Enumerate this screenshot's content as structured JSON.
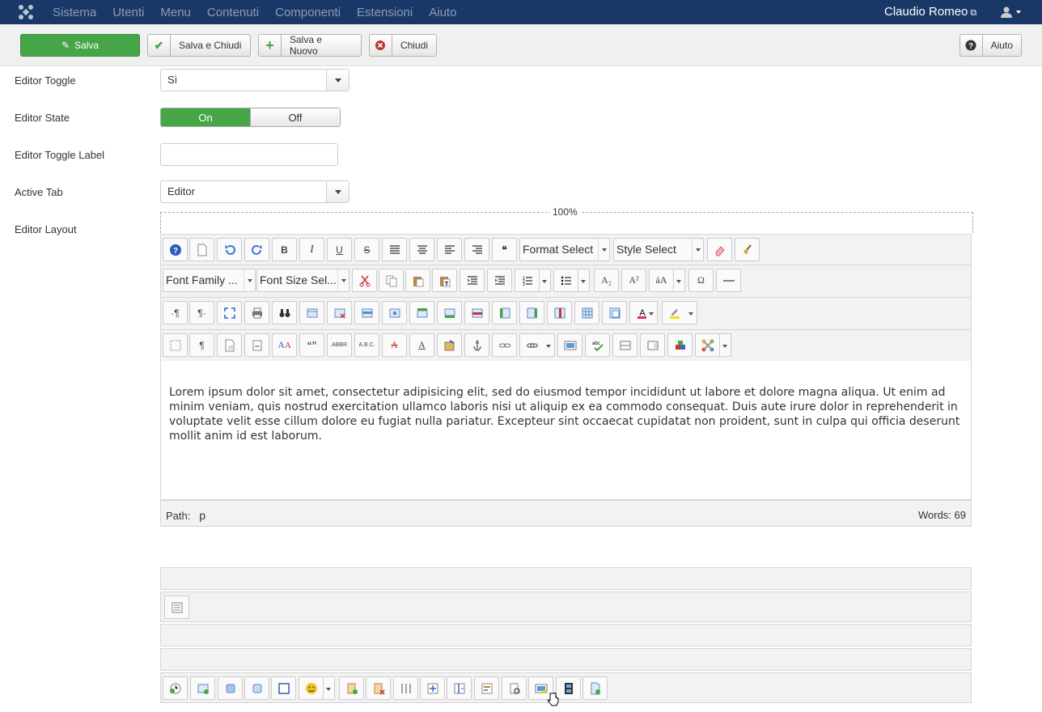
{
  "navbar": {
    "menu": [
      "Sistema",
      "Utenti",
      "Menu",
      "Contenuti",
      "Componenti",
      "Estensioni",
      "Aiuto"
    ],
    "user": "Claudio Romeo"
  },
  "toolbar": {
    "save": "Salva",
    "save_close": "Salva e Chiudi",
    "save_new": "Salva e Nuovo",
    "close": "Chiudi",
    "help": "Aiuto"
  },
  "form": {
    "editor_toggle_label": "Editor Toggle",
    "editor_toggle_value": "Sì",
    "editor_state_label": "Editor State",
    "on": "On",
    "off": "Off",
    "toggle_label_label": "Editor Toggle Label",
    "toggle_label_value": "",
    "active_tab_label": "Active Tab",
    "active_tab_value": "Editor",
    "editor_layout_label": "Editor Layout"
  },
  "editor": {
    "width_percent": "100%",
    "format_select": "Format Select",
    "style_select": "Style Select",
    "font_family": "Font Family ...",
    "font_size": "Font Size Sel...",
    "content": "Lorem ipsum dolor sit amet, consectetur adipisicing elit, sed do eiusmod tempor incididunt ut labore et dolore magna aliqua. Ut enim ad minim veniam, quis nostrud exercitation ullamco laboris nisi ut aliquip ex ea commodo consequat. Duis aute irure dolor in reprehenderit in voluptate velit esse cillum dolore eu fugiat nulla pariatur. Excepteur sint occaecat cupidatat non proident, sunt in culpa qui officia deserunt mollit anim id est laborum.",
    "path_label": "Path:",
    "path_value": "p",
    "words": "Words: 69"
  },
  "colors": {
    "navbar": "#1a3867",
    "green": "#46a546"
  }
}
